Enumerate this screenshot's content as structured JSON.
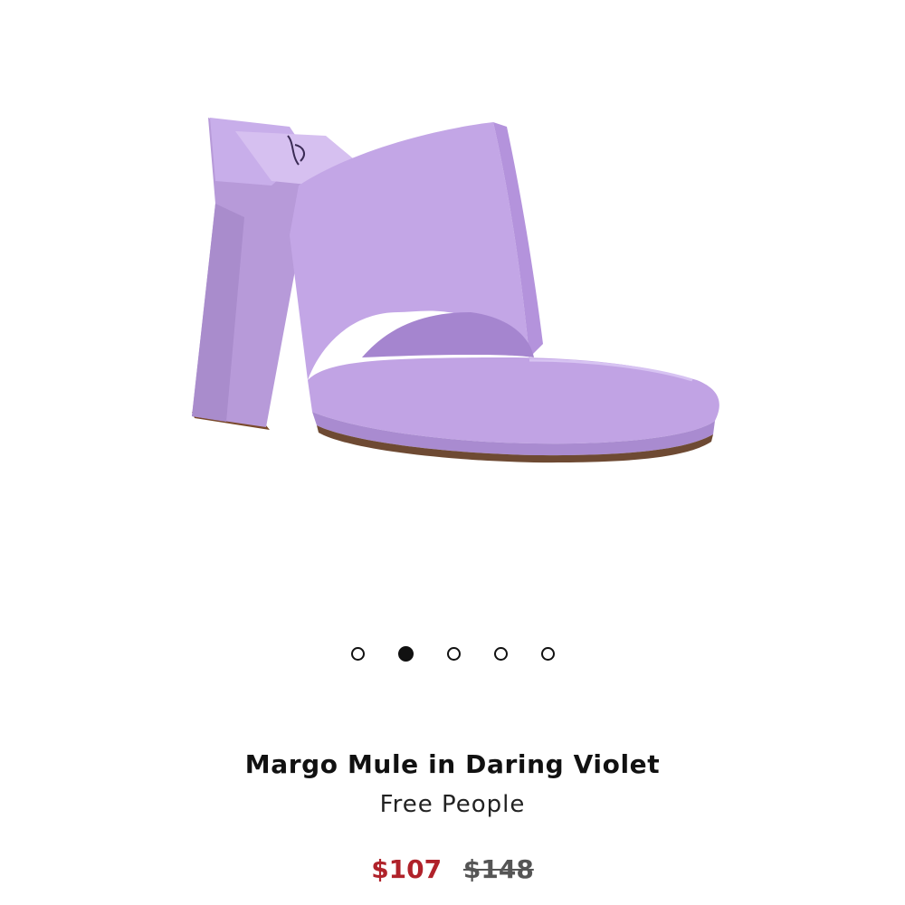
{
  "product": {
    "title": "Margo Mule in Daring Violet",
    "brand": "Free People",
    "sale_price": "$107",
    "original_price": "$148",
    "colors": {
      "suede": "#c3a6e6",
      "sale_price": "#b0222a"
    }
  },
  "carousel": {
    "slide_count": 5,
    "active_index": 1,
    "dots": [
      {
        "active": false
      },
      {
        "active": true
      },
      {
        "active": false
      },
      {
        "active": false
      },
      {
        "active": false
      }
    ]
  }
}
